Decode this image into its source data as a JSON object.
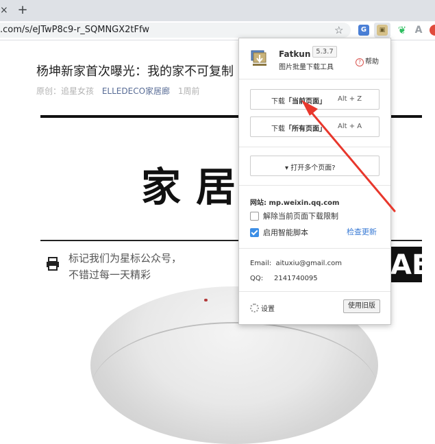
{
  "browser": {
    "tab_close": "×",
    "new_tab": "+",
    "url": ".com/s/eJTwP8c9-r_SQMNGX2tFfw",
    "star": "☆",
    "extensions": {
      "translate": "G",
      "fatkun": "▣",
      "evernote": "❦",
      "a": "A"
    }
  },
  "article": {
    "title": "杨坤新家首次曝光：我的家不可复制",
    "origin": "原创：追星女孩",
    "account": "ELLEDECO家居廊",
    "time": "1周前",
    "big_title": "家居",
    "promo_line1": "标记我们为星标公众号，",
    "promo_line2": "不错过每一天精彩",
    "block_letters": "AE"
  },
  "popup": {
    "name": "Fatkun",
    "subtitle": "图片批量下载工具",
    "version": "5.3.7",
    "help": "帮助",
    "btn_current_prefix": "下载",
    "btn_current_bold": "「当前页面」",
    "btn_current_key": "Alt + Z",
    "btn_all_prefix": "下载",
    "btn_all_bold": "「所有页面」",
    "btn_all_key": "Alt + A",
    "btn_multi": "▾ 打开多个页面?",
    "site_label": "网站:",
    "site_value": "mp.weixin.qq.com",
    "opt_unlimit": "解除当前页面下载限制",
    "opt_smart": "启用智能脚本",
    "check_update": "检查更新",
    "email_label": "Email:",
    "email_value": "aituxiu@gmail.com",
    "qq_label": "QQ:",
    "qq_value": "2141740095",
    "settings": "设置",
    "old_version": "使用旧版"
  },
  "colors": {
    "accent_blue": "#3a7bd5",
    "arrow_red": "#e8372c"
  }
}
